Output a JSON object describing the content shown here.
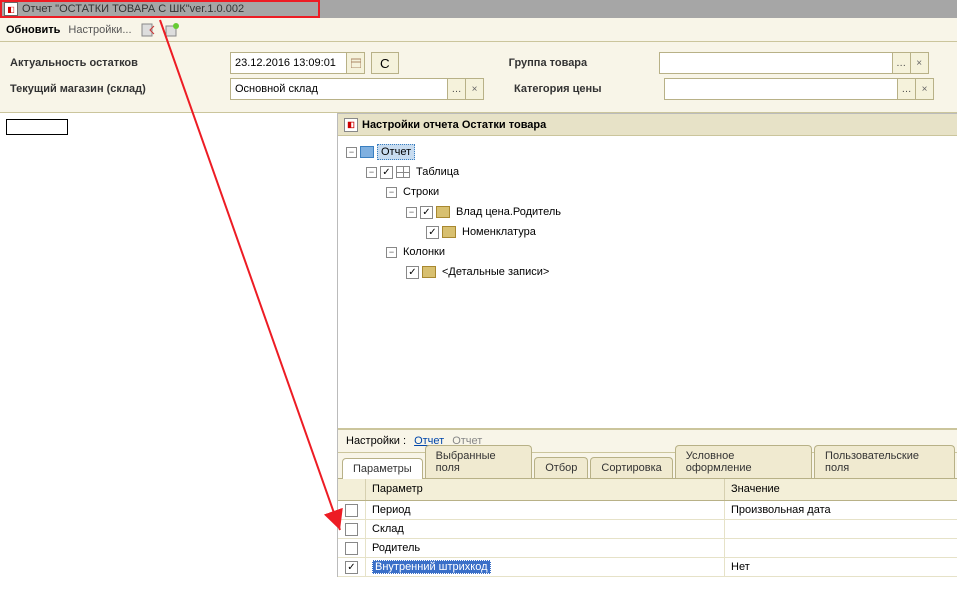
{
  "window": {
    "title_prefix": "Отчет  \"ОСТАТКИ ТОВАРА С ШК\" ",
    "version": "ver.1.0.002"
  },
  "toolbar": {
    "refresh": "Обновить",
    "settings": "Настройки..."
  },
  "filters": {
    "actuality_label": "Актуальность остатков",
    "actuality_value": "23.12.2016 13:09:01",
    "c_button": "С",
    "group_label": "Группа товара",
    "group_value": "",
    "store_label": "Текущий магазин (склад)",
    "store_value": "Основной склад",
    "price_cat_label": "Категория цены",
    "price_cat_value": ""
  },
  "settings_panel": {
    "title": "Настройки отчета  Остатки товара",
    "tree": {
      "root": "Отчет",
      "table": "Таблица",
      "rows": "Строки",
      "row1": "Влад цена.Родитель",
      "row2": "Номенклатура",
      "cols": "Колонки",
      "col1": "<Детальные записи>"
    },
    "bar": {
      "label": "Настройки :",
      "link1": "Отчет",
      "link2": "Отчет"
    },
    "tabs": [
      "Параметры",
      "Выбранные поля",
      "Отбор",
      "Сортировка",
      "Условное оформление",
      "Пользовательские поля"
    ],
    "grid": {
      "col_param": "Параметр",
      "col_value": "Значение",
      "rows": [
        {
          "checked": false,
          "param": "Период",
          "value": "Произвольная дата"
        },
        {
          "checked": false,
          "param": "Склад",
          "value": ""
        },
        {
          "checked": false,
          "param": "Родитель",
          "value": ""
        },
        {
          "checked": true,
          "param": "Внутренний штрихкод",
          "value": "Нет"
        }
      ]
    }
  }
}
